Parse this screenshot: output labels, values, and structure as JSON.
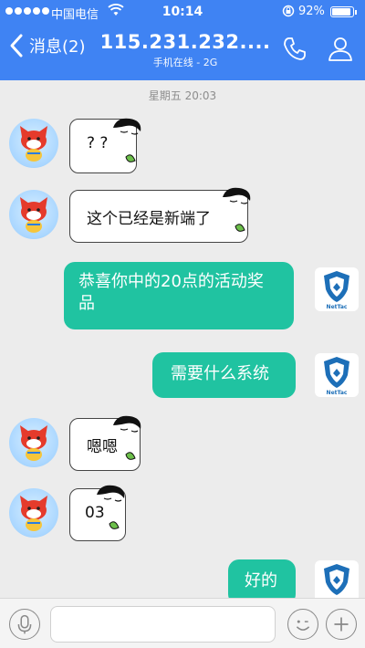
{
  "status_bar": {
    "carrier": "中国电信",
    "time": "10:14",
    "battery": "92%"
  },
  "nav": {
    "back_label": "消息(2)",
    "title": "115.231.232....",
    "subtitle": "手机在线 - 2G"
  },
  "chat": {
    "timestamp": "星期五 20:03",
    "messages": [
      {
        "side": "left",
        "text": "? ?"
      },
      {
        "side": "left",
        "text": "这个已经是新端了"
      },
      {
        "side": "right",
        "line1": "恭喜你中的20点的活动奖",
        "line2": "品"
      },
      {
        "side": "right",
        "text": "需要什么系统"
      },
      {
        "side": "left",
        "text": "嗯嗯"
      },
      {
        "side": "left",
        "text": "03"
      },
      {
        "side": "right",
        "text": "好的"
      }
    ],
    "right_avatar_text": "网泰",
    "right_avatar_sub": "NetTac"
  },
  "input": {
    "placeholder": ""
  },
  "colors": {
    "header": "#3f83f3",
    "outgoing_bubble": "#20c3a1",
    "background": "#ececec"
  }
}
